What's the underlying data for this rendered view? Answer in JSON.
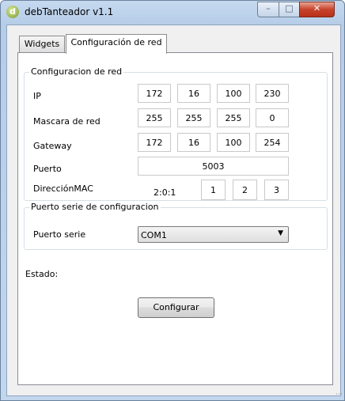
{
  "window": {
    "title": "debTanteador v1.1",
    "app_icon_letter": "d"
  },
  "window_controls": {
    "minimize": "–",
    "maximize": "□",
    "close": "✕"
  },
  "tabs": [
    {
      "label": "Widgets",
      "active": false
    },
    {
      "label": "Configuración de red",
      "active": true
    }
  ],
  "network_group": {
    "title": "Configuracion de red",
    "ip": {
      "label": "IP",
      "octets": [
        "172",
        "16",
        "100",
        "230"
      ]
    },
    "mask": {
      "label": "Mascara de red",
      "octets": [
        "255",
        "255",
        "255",
        "0"
      ]
    },
    "gateway": {
      "label": "Gateway",
      "octets": [
        "172",
        "16",
        "100",
        "254"
      ]
    },
    "port": {
      "label": "Puerto",
      "value": "5003"
    },
    "mac": {
      "label": "DirecciónMAC",
      "prefix": "2:0:1",
      "octets": [
        "1",
        "2",
        "3"
      ]
    }
  },
  "serial_group": {
    "title": "Puerto serie de configuracion",
    "port_label": "Puerto serie",
    "selected_port": "COM1",
    "dropdown_icon": "chevron-down-icon"
  },
  "status": {
    "label": "Estado:"
  },
  "configure_button": {
    "label": "Configurar"
  },
  "colors": {
    "title_bar": "#c6d9ef",
    "close_button": "#c8432c",
    "panel": "#ffffff"
  }
}
